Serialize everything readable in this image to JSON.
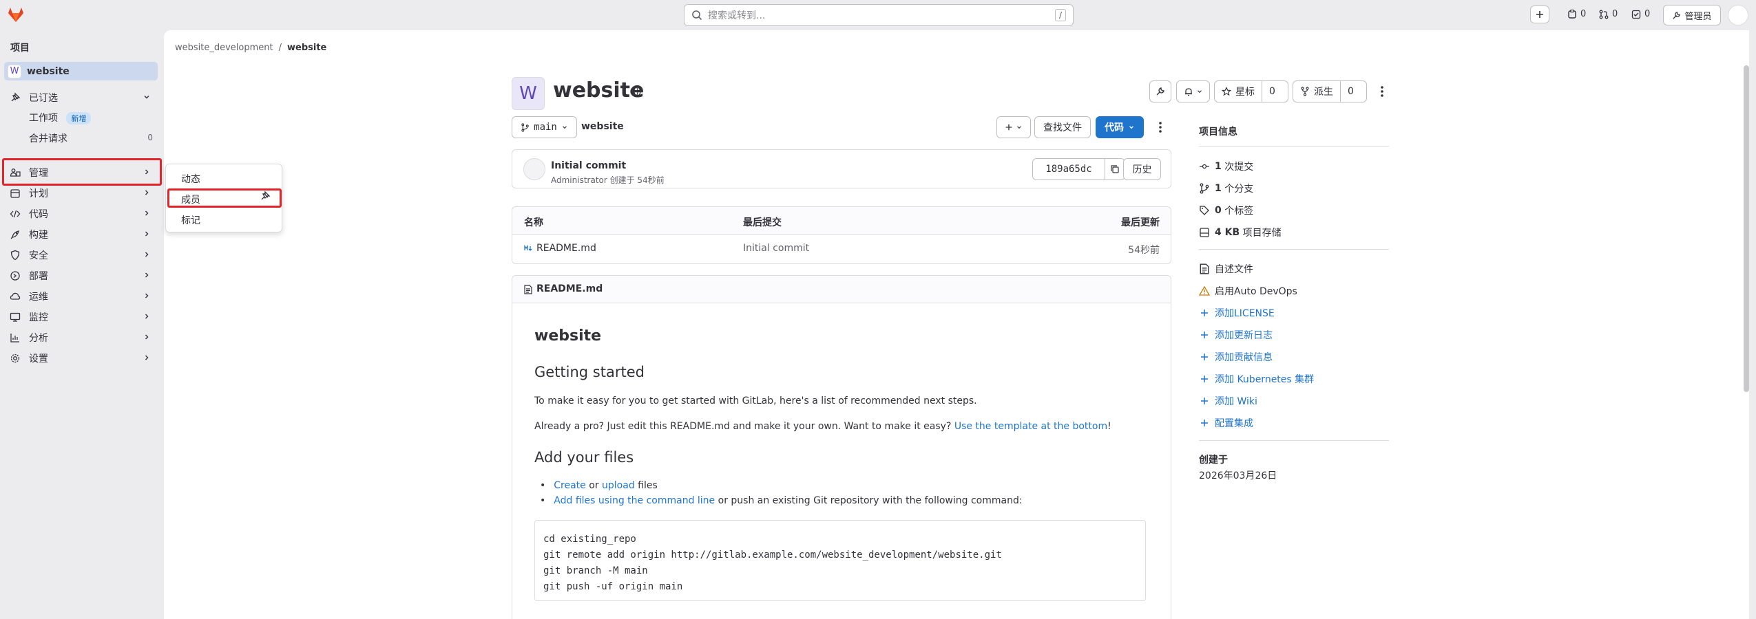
{
  "topbar": {
    "search_placeholder": "搜索或转到...",
    "search_shortcut": "/",
    "counts": {
      "issues": "0",
      "merge_requests": "0",
      "todos": "0"
    },
    "admin_label": "管理员"
  },
  "sidebar": {
    "heading": "项目",
    "project": {
      "avatar_letter": "W",
      "name": "website"
    },
    "pinned": {
      "label": "已订选",
      "items": [
        {
          "label": "工作项",
          "badge": "新增"
        },
        {
          "label": "合并请求",
          "count": "0"
        }
      ]
    },
    "items": [
      {
        "label": "管理",
        "icon": "users-icon"
      },
      {
        "label": "计划",
        "icon": "calendar-icon"
      },
      {
        "label": "代码",
        "icon": "code-icon"
      },
      {
        "label": "构建",
        "icon": "rocket-icon"
      },
      {
        "label": "安全",
        "icon": "shield-icon"
      },
      {
        "label": "部署",
        "icon": "deploy-icon"
      },
      {
        "label": "运维",
        "icon": "cloud-icon"
      },
      {
        "label": "监控",
        "icon": "monitor-icon"
      },
      {
        "label": "分析",
        "icon": "chart-icon"
      },
      {
        "label": "设置",
        "icon": "gear-icon"
      }
    ]
  },
  "flyout": {
    "items": [
      "动态",
      "成员",
      "标记"
    ]
  },
  "breadcrumb": {
    "group": "website_development",
    "separator": "/",
    "current": "website"
  },
  "project": {
    "avatar_letter": "W",
    "title": "website",
    "star_label": "星标",
    "star_count": "0",
    "fork_label": "派生",
    "fork_count": "0"
  },
  "repo_bar": {
    "branch": "main",
    "path": "website",
    "find_file": "查找文件",
    "code_button": "代码"
  },
  "commit": {
    "title": "Initial commit",
    "meta": "Administrator 创建于 54秒前",
    "sha": "189a65dc",
    "history": "历史"
  },
  "file_table": {
    "headers": [
      "名称",
      "最后提交",
      "最后更新"
    ],
    "rows": [
      {
        "name": "README.md",
        "commit": "Initial commit",
        "updated": "54秒前"
      }
    ]
  },
  "readme": {
    "filename": "README.md",
    "h1": "website",
    "h2_getting_started": "Getting started",
    "p1": "To make it easy for you to get started with GitLab, here's a list of recommended next steps.",
    "p2_prefix": "Already a pro? Just edit this README.md and make it your own. Want to make it easy? ",
    "p2_link": "Use the template at the bottom",
    "p2_suffix": "!",
    "h2_add_files": "Add your files",
    "li1_create": "Create",
    "li1_or": " or ",
    "li1_upload": "upload",
    "li1_suffix": " files",
    "li2_link": "Add files using the command line",
    "li2_suffix": " or push an existing Git repository with the following command:",
    "code": "cd existing_repo\ngit remote add origin http://gitlab.example.com/website_development/website.git\ngit branch -M main\ngit push -uf origin main"
  },
  "project_info": {
    "title": "项目信息",
    "stats": [
      {
        "icon": "commit-icon",
        "value": "1",
        "label": "次提交"
      },
      {
        "icon": "branch-icon",
        "value": "1",
        "label": "个分支"
      },
      {
        "icon": "tag-icon",
        "value": "0",
        "label": "个标签"
      },
      {
        "icon": "storage-icon",
        "value": "4 KB",
        "label": "项目存储"
      }
    ],
    "readme_link": "自述文件",
    "autodevops": "启用Auto DevOps",
    "add_links": [
      "添加LICENSE",
      "添加更新日志",
      "添加贡献信息",
      "添加 Kubernetes 集群",
      "添加 Wiki",
      "配置集成"
    ],
    "created_label": "创建于",
    "created_date": "2026年03月26日"
  }
}
